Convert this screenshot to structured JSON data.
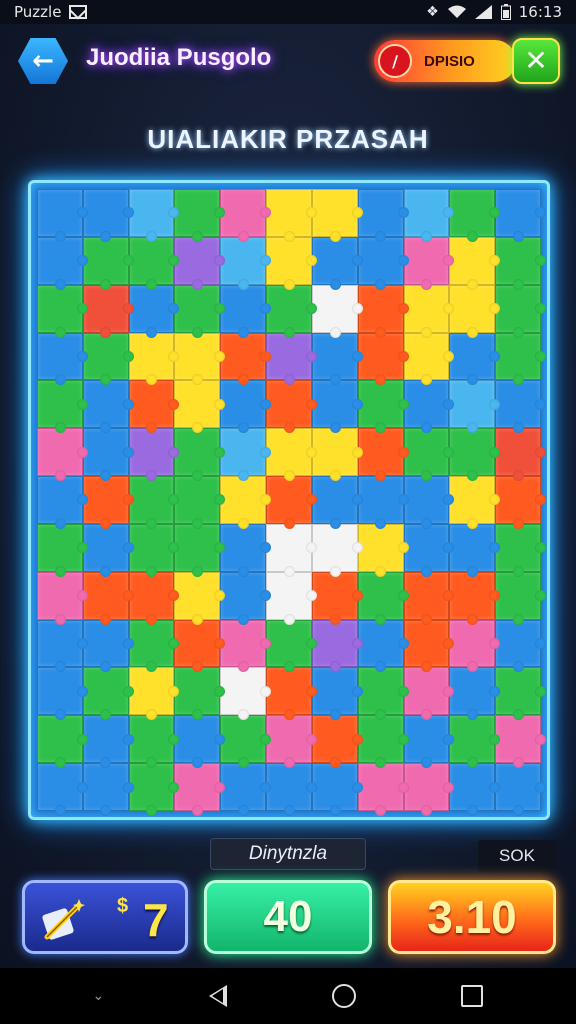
{
  "status_bar": {
    "app_name": "Puzzle",
    "time": "16:13"
  },
  "header": {
    "title": "Juodiia Pusgolo",
    "bonus_label": "DPISIO"
  },
  "subtitle": "UIALIAKIR PRZASAH",
  "board": {
    "columns": 11,
    "rows": 13,
    "colors": {
      "B": "#2a8ee6",
      "G": "#2ec04a",
      "Y": "#ffe02a",
      "O": "#ff5a1f",
      "R": "#f0503a",
      "P": "#9a6ae0",
      "K": "#f06ab0",
      "W": "#f4f4f4",
      "L": "#4ab6f0",
      "D": "#1e6ccf"
    },
    "layout": [
      "BBLGKYYBLGB",
      "BGGPLYBBKYG",
      "GRBGBGWOYYG",
      "BGYYOPBOYBG",
      "GBOYBOBGBLB",
      "KBPGLYYOGGR",
      "BOGGYOBBBYO",
      "GBGGBWWYBBG",
      "KOOYBWOGOOG",
      "BBGOKGPBOKB",
      "BGYGWOBGKBG",
      "GBGBGKOGBGK",
      "BBGKBBBKKBB"
    ]
  },
  "hud": {
    "level_label": "Dinytnzla",
    "mode_badge": "SOK",
    "coins_currency": "$",
    "coins_value": "7",
    "score_value": "40",
    "time_value": "3.10"
  }
}
